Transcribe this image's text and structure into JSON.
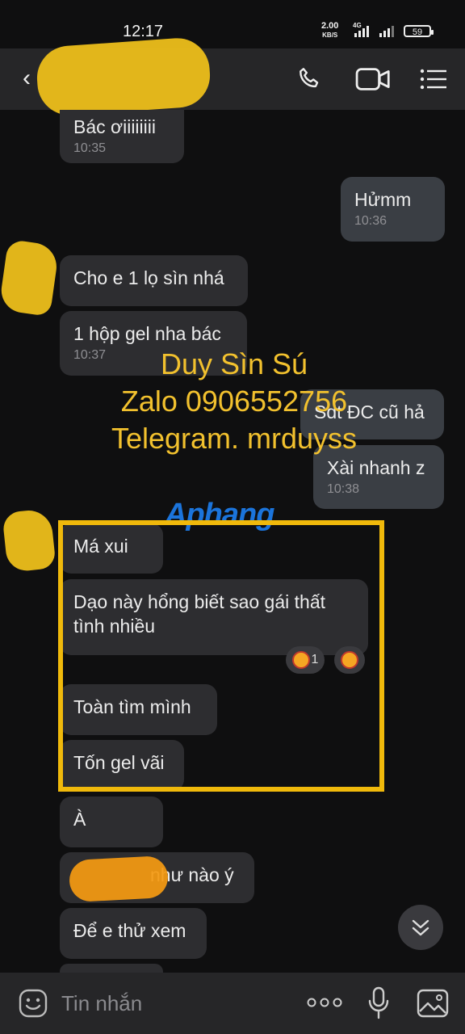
{
  "status_bar": {
    "time": "12:17",
    "speed_value": "2.00",
    "speed_unit": "KB/S",
    "network": "4G",
    "battery": "59"
  },
  "header": {
    "contact_name": "",
    "back_icon": "chevron-left-icon",
    "call_icon": "phone-icon",
    "video_icon": "video-call-icon",
    "menu_icon": "list-menu-icon"
  },
  "messages": [
    {
      "id": "m1",
      "side": "in",
      "text": "Bác ơiiiiiiii",
      "time": "10:35"
    },
    {
      "id": "m2",
      "side": "out",
      "text": "Hửmm",
      "time": "10:36"
    },
    {
      "id": "m3",
      "side": "in",
      "text": "Cho e 1 lọ sìn nhá",
      "time": ""
    },
    {
      "id": "m4",
      "side": "in",
      "text": "1 hộp gel nha bác",
      "time": "10:37"
    },
    {
      "id": "m5",
      "side": "out",
      "text": "Sdt ĐC cũ hả",
      "time": ""
    },
    {
      "id": "m6",
      "side": "out",
      "text": "Xài nhanh z",
      "time": "10:38"
    },
    {
      "id": "m7",
      "side": "in",
      "text": "Má xui",
      "time": ""
    },
    {
      "id": "m8",
      "side": "in",
      "text": "Dạo này hổng biết sao gái thất tình nhiều",
      "time": ""
    },
    {
      "id": "m9",
      "side": "in",
      "text": "Toàn tìm mình",
      "time": ""
    },
    {
      "id": "m10",
      "side": "in",
      "text": "Tốn gel vãi",
      "time": ""
    },
    {
      "id": "m11",
      "side": "in",
      "text": "À",
      "time": ""
    },
    {
      "id": "m12",
      "side": "in",
      "text": "như nào ý",
      "time": ""
    },
    {
      "id": "m13",
      "side": "in",
      "text": "Để e thử xem",
      "time": ""
    }
  ],
  "reaction": {
    "count": "1",
    "icon": "laughing-emoji-icon"
  },
  "watermark": {
    "line1": "Duy Sìn Sú",
    "line2": "Zalo 0906552756",
    "line3": "Telegram. mrduyss",
    "logo": "Aphang"
  },
  "colors": {
    "highlight": "#f0b90b",
    "watermark": "#f2c12e",
    "bubble_in": "#2d2d30",
    "bubble_out": "#3a3e44"
  },
  "input_bar": {
    "placeholder": "Tin nhắn",
    "sticker_icon": "emoji-icon",
    "more_icon": "more-dots-icon",
    "mic_icon": "microphone-icon",
    "image_icon": "image-icon"
  }
}
